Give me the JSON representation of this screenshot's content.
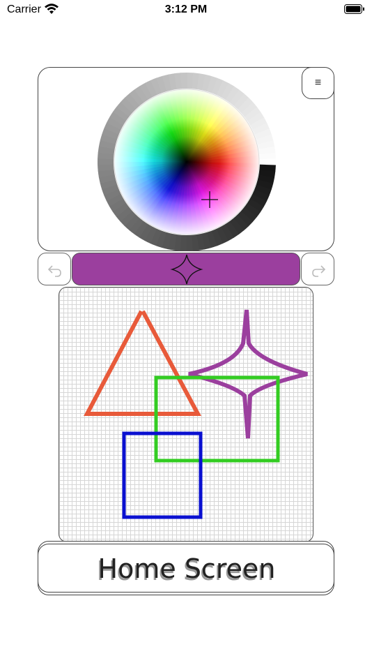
{
  "status_bar": {
    "carrier": "Carrier",
    "time": "3:12 PM"
  },
  "picker": {
    "menu_glyph": "≡"
  },
  "toolbar": {
    "selected_tool": "sparkle-star-icon",
    "color": "#9b3f9e"
  },
  "canvas": {
    "shapes": [
      {
        "name": "triangle",
        "color": "#e85a3a"
      },
      {
        "name": "star",
        "color": "#9b3f9e"
      },
      {
        "name": "green-rect",
        "color": "#33cc22"
      },
      {
        "name": "blue-rect",
        "color": "#0a10d0"
      }
    ]
  },
  "home": {
    "label": "Home Screen"
  },
  "icons": {
    "undo": "undo-arrow-icon",
    "redo": "redo-arrow-icon",
    "wifi": "wifi-icon",
    "battery": "battery-icon"
  }
}
